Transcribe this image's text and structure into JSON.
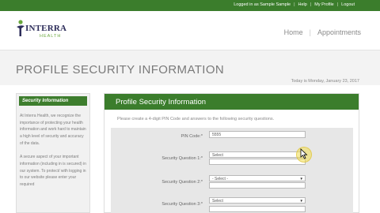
{
  "topbar": {
    "links": [
      "Logged in as Sample Sample",
      "Help",
      "My Profile",
      "Logout"
    ]
  },
  "logo": {
    "name": "INTERRA",
    "sub": "HEALTH"
  },
  "mainnav": {
    "home": "Home",
    "appointments": "Appointments"
  },
  "page": {
    "title": "PROFILE SECURITY INFORMATION",
    "date": "Today is Monday, January 23, 2017"
  },
  "sidebar": {
    "header": "Security Information",
    "paragraphs": [
      "At Interra Health, we recognize the importance of protecting your health information and work hard to maintain a high level of security and accuracy of the data.",
      "A secure aspect of your important information (including in is secured) in our system. To protect/ with logging in to our website please enter your required"
    ]
  },
  "panel": {
    "header": "Profile Security Information",
    "instructions": "Please create a 4-digit PIN Code and answers to the following security questions.",
    "pin": {
      "label": "PIN Code:*",
      "value": "5555"
    },
    "questions": [
      {
        "label": "Security Question 1:*",
        "selected": "Select"
      },
      {
        "label": "Security Question 2:*",
        "selected": "- Select -"
      },
      {
        "label": "Security Question 3:*",
        "selected": "Select"
      }
    ]
  },
  "colors": {
    "brand_green": "#3b7d2c",
    "logo_navy": "#2d2d5a",
    "logo_green": "#6aa83d"
  }
}
